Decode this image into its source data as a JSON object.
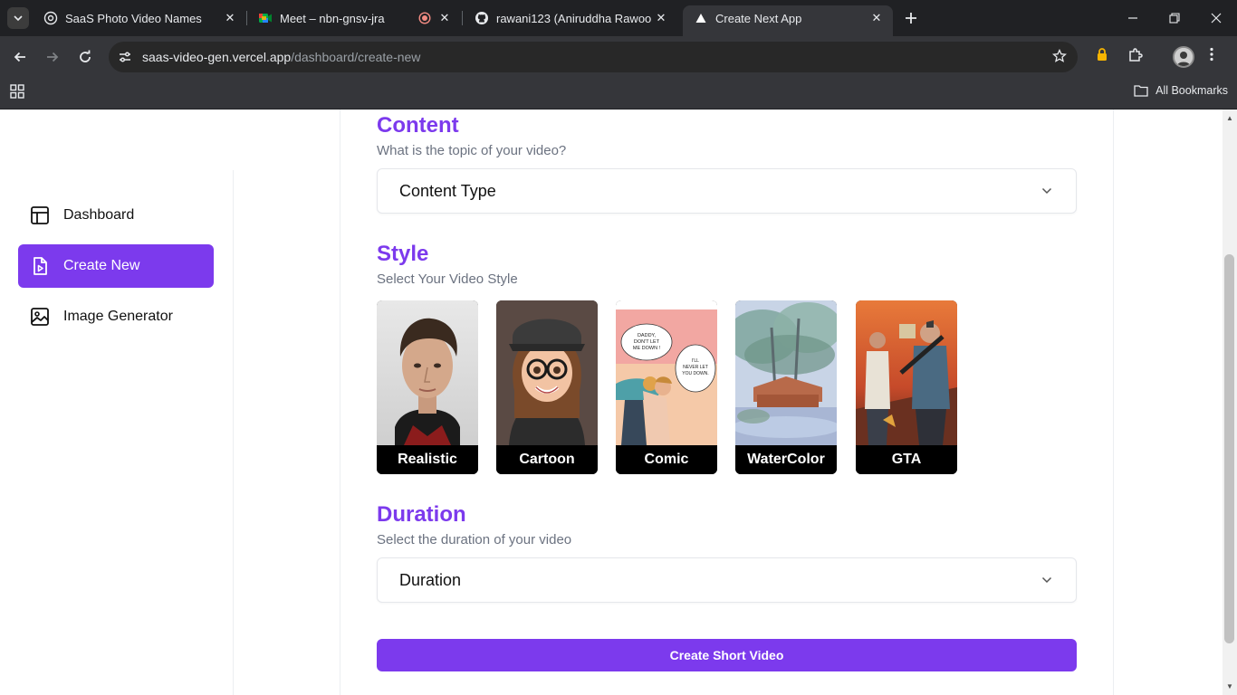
{
  "browser": {
    "tabs": [
      {
        "title": "SaaS Photo Video Names",
        "icon": "chatgpt-icon"
      },
      {
        "title": "Meet – nbn-gnsv-jra",
        "icon": "google-meet-icon",
        "recording": true
      },
      {
        "title": "rawani123 (Aniruddha Rawool)",
        "icon": "github-icon"
      },
      {
        "title": "Create Next App",
        "icon": "vercel-icon",
        "active": true
      }
    ],
    "url_host": "saas-video-gen.vercel.app",
    "url_path": "/dashboard/create-new",
    "bookmarks_label": "All Bookmarks"
  },
  "sidebar": {
    "items": [
      {
        "label": "Dashboard",
        "icon": "layout-icon"
      },
      {
        "label": "Create New",
        "icon": "file-video-icon",
        "active": true
      },
      {
        "label": "Image Generator",
        "icon": "image-icon"
      }
    ]
  },
  "content": {
    "title": "Content",
    "subtitle": "What is the topic of your video?",
    "select_value": "Content Type"
  },
  "style": {
    "title": "Style",
    "subtitle": "Select Your Video Style",
    "options": [
      "Realistic",
      "Cartoon",
      "Comic",
      "WaterColor",
      "GTA"
    ]
  },
  "duration": {
    "title": "Duration",
    "subtitle": "Select the duration of your video",
    "select_value": "Duration"
  },
  "cta_label": "Create Short Video",
  "colors": {
    "accent": "#7c3aed",
    "browser_dark": "#202124",
    "browser_toolbar": "#35363a"
  }
}
